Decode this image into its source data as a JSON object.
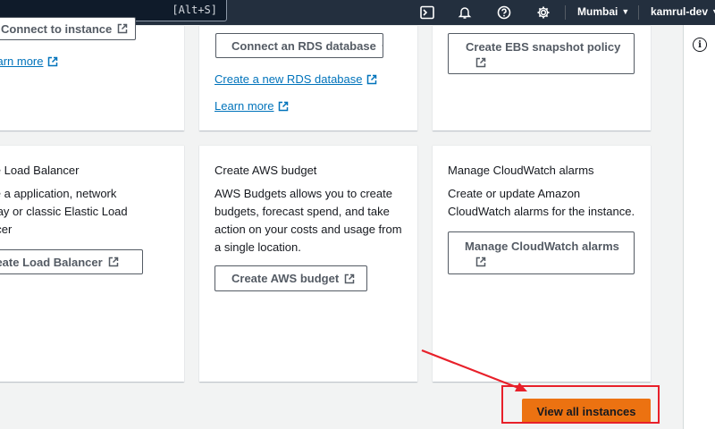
{
  "topbar": {
    "search_shortcut": "[Alt+S]",
    "icons": [
      "terminal-icon",
      "bell-icon",
      "help-icon",
      "gear-icon"
    ],
    "region": "Mumbai",
    "account": "kamrul-dev"
  },
  "cards_row1": {
    "card1": {
      "button": "Connect to instance",
      "link": "Learn more"
    },
    "card2": {
      "button": "Connect an RDS database",
      "link1": "Create a new RDS database",
      "link2": "Learn more"
    },
    "card3": {
      "button_line1": "Create EBS snapshot policy"
    }
  },
  "cards_row2": {
    "card1": {
      "title": "Create Load Balancer",
      "desc_line1": "Create a application, network",
      "desc_line2": "gateway or classic Elastic Load",
      "desc_line3": "Balancer",
      "button": "Create Load Balancer"
    },
    "card2": {
      "title": "Create AWS budget",
      "desc_line1": "AWS Budgets allows you to create",
      "desc_line2": "budgets, forecast spend, and take",
      "desc_line3": "action on your costs and usage from",
      "desc_line4": "a single location.",
      "button": "Create AWS budget"
    },
    "card3": {
      "title": "Manage CloudWatch alarms",
      "desc_line1": "Create or update Amazon",
      "desc_line2": "CloudWatch alarms for the instance.",
      "button_line1": "Manage CloudWatch alarms"
    }
  },
  "footer": {
    "primary_button": "View all instances"
  },
  "colors": {
    "nav": "#232f3e",
    "primary": "#ec7211",
    "link": "#0073bb",
    "annotation": "#e8202a"
  }
}
